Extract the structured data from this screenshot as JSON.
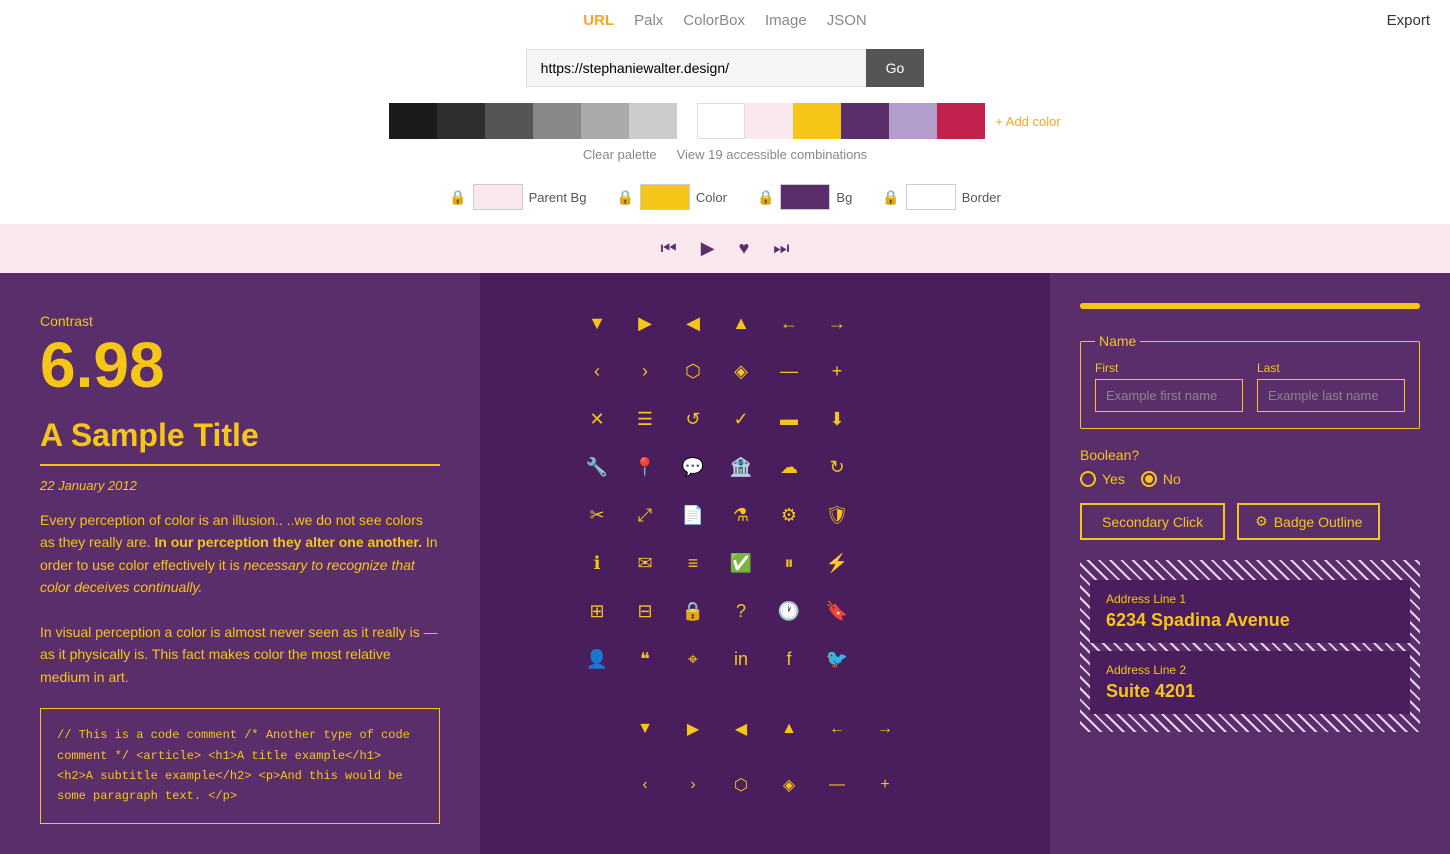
{
  "nav": {
    "links": [
      {
        "label": "URL",
        "active": true
      },
      {
        "label": "Palx",
        "active": false
      },
      {
        "label": "ColorBox",
        "active": false
      },
      {
        "label": "Image",
        "active": false
      },
      {
        "label": "JSON",
        "active": false
      }
    ],
    "export_label": "Export"
  },
  "url_bar": {
    "value": "https://stephaniewalter.design/",
    "go_label": "Go"
  },
  "swatches": {
    "left": [
      {
        "color": "#1a1a1a"
      },
      {
        "color": "#2e2e2e"
      },
      {
        "color": "#555555"
      },
      {
        "color": "#888888"
      },
      {
        "color": "#aaaaaa"
      },
      {
        "color": "#cccccc"
      }
    ],
    "right": [
      {
        "color": "#ffffff"
      },
      {
        "color": "#f9e8ed"
      },
      {
        "color": "#f5c518"
      },
      {
        "color": "#5a2d6b"
      },
      {
        "color": "#b39dcc"
      },
      {
        "color": "#c0224d"
      }
    ],
    "add_label": "+ Add color"
  },
  "palette_actions": {
    "clear": "Clear palette",
    "view": "View 19 accessible combinations"
  },
  "color_config": [
    {
      "label": "Parent Bg",
      "color": "#f9e8ed"
    },
    {
      "label": "Color",
      "color": "#f5c518"
    },
    {
      "label": "Bg",
      "color": "#5a2d6b"
    },
    {
      "label": "Border",
      "color": "#ffffff"
    }
  ],
  "left_panel": {
    "contrast_label": "Contrast",
    "contrast_value": "6.98",
    "sample_title": "A Sample Title",
    "date": "22 January 2012",
    "text1": "Every perception of color is an illusion.. ..we do not see colors as they really are.",
    "text_bold": "In our perception they alter one another.",
    "text2": "In order to use color effectively it is",
    "text_italic": "necessary to recognize that color deceives continually.",
    "text3": "In visual perception a color is almost never seen as it really is — as it physically is. This fact makes color the most relative medium in art.",
    "code": "// This is a code comment\n/* Another type of code comment */\n\n<article>\n  <h1>A title example</h1>\n  <h2>A subtitle example</h2>\n  <p>And this would be some paragraph text.\n</p>"
  },
  "right_panel": {
    "name_legend": "Name",
    "first_label": "First",
    "last_label": "Last",
    "first_placeholder": "Example first name",
    "last_placeholder": "Example last name",
    "boolean_label": "Boolean?",
    "yes_label": "Yes",
    "no_label": "No",
    "secondary_click": "Secondary Click",
    "badge_icon": "⚙",
    "badge_label": "Badge Outline",
    "address1_label": "Address Line 1",
    "address1_value": "6234 Spadina Avenue",
    "address2_label": "Address Line 2",
    "address2_value": "Suite 4201"
  }
}
